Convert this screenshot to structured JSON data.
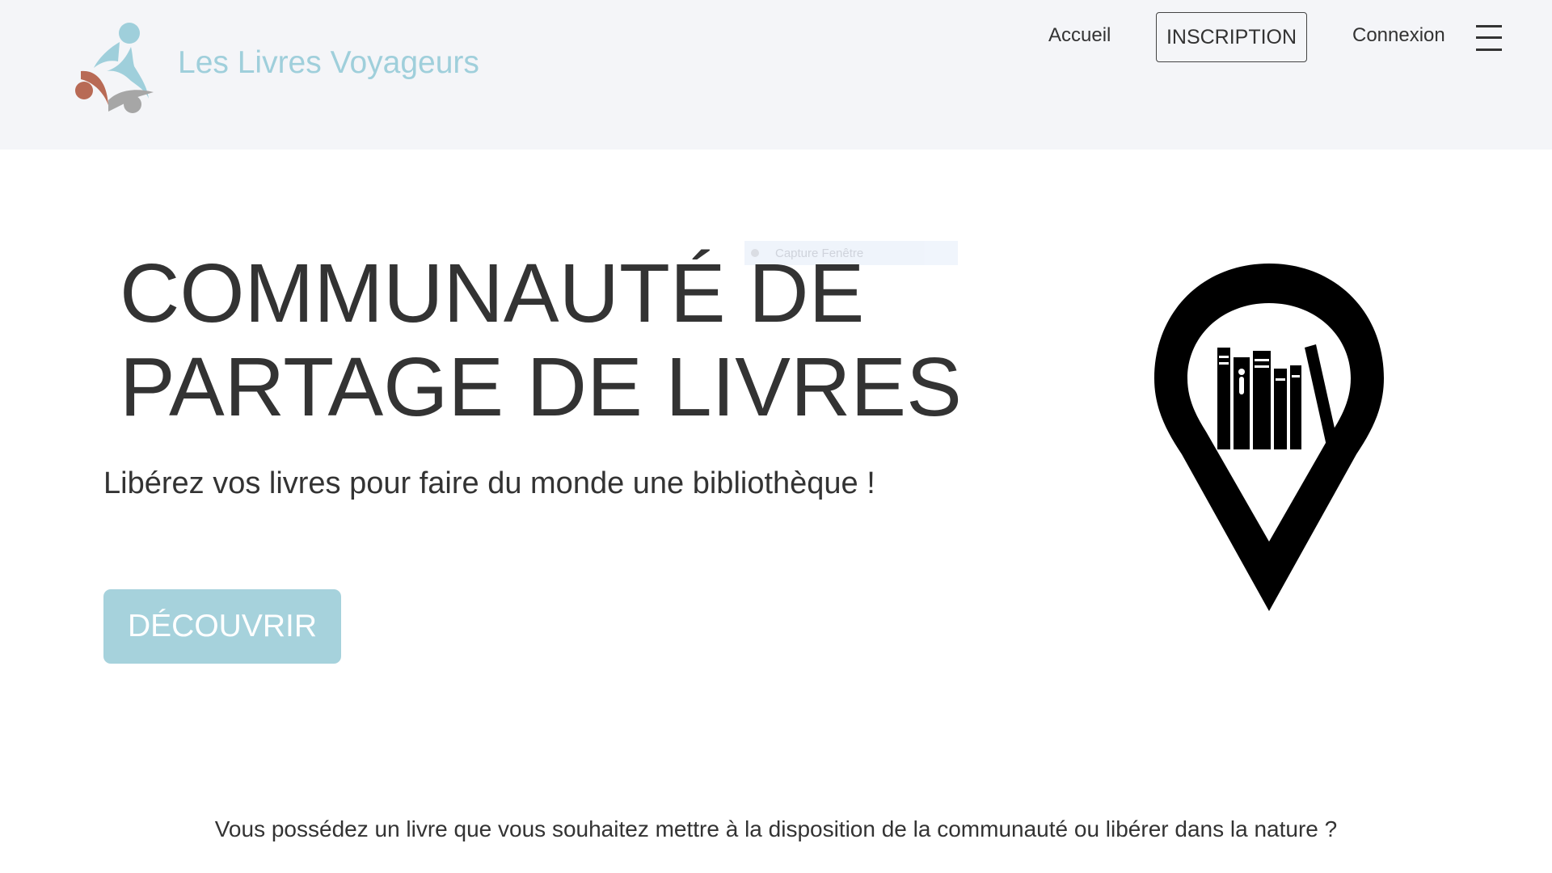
{
  "header": {
    "site_name": "Les Livres Voyageurs",
    "nav": {
      "home": "Accueil",
      "register": "INSCRIPTION",
      "login": "Connexion"
    },
    "menu_icon": "hamburger-menu-icon"
  },
  "overlay": {
    "label": "Capture Fenêtre"
  },
  "hero": {
    "title_line1": "COMMUNAUTÉ DE",
    "title_line2": "PARTAGE DE LIVRES",
    "subtitle": "Libérez vos livres pour faire du monde une bibliothèque !",
    "cta_label": "DÉCOUVRIR",
    "illustration_icon": "map-pin-books-icon"
  },
  "intro": {
    "text": "Vous possédez un livre que vous souhaitez mettre à la disposition de la communauté ou libérer dans la nature ?"
  },
  "colors": {
    "header_background": "#f4f5f8",
    "brand_text": "#9fcfdb",
    "logo_blue": "#9fcfdb",
    "logo_red": "#b86a55",
    "logo_grey": "#a6a6a6",
    "cta_background": "#a6d2dc",
    "text": "#333333"
  }
}
